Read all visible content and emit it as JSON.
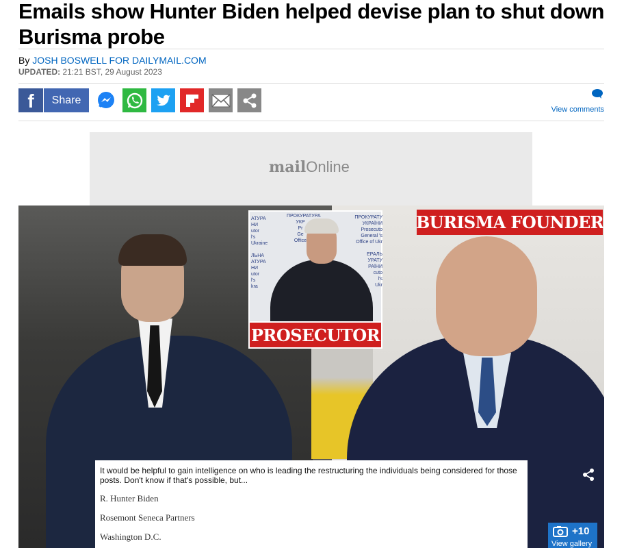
{
  "article": {
    "headline": "Emails show Hunter Biden helped devise plan to shut down Burisma probe",
    "byline_prefix": "By ",
    "author": "JOSH BOSWELL FOR DAILYMAIL.COM",
    "updated_label": "UPDATED:",
    "updated_time": " 21:21 BST, 29 August 2023"
  },
  "share": {
    "facebook_label": "Share",
    "buttons": [
      "messenger-icon",
      "whatsapp-icon",
      "twitter-icon",
      "flipboard-icon",
      "email-icon",
      "share-icon"
    ],
    "colors": {
      "facebook": "#3b5998",
      "whatsapp": "#2fb942",
      "twitter": "#1da1f2",
      "flipboard": "#e12828",
      "grey": "#888888"
    }
  },
  "comments": {
    "label": "View comments"
  },
  "ad": {
    "logo_bold": "mail",
    "logo_light": "Online"
  },
  "image": {
    "prosecutor_caption": "PROSECUTOR",
    "founder_caption": "BURISMA FOUNDER",
    "sign_left": "АТУРА\nНИ\nutor\nl's\nUkraine\n\nЛЬНА\nАТУРА\nНИ\nutor\nl's\nkra",
    "sign_mid": "ПРОКУРАТУРА\nУКР\nPr\nGe\nOffice",
    "sign_right": "ПРОКУРАТУ\nУКРАЇНИ\nProsecuto\nGeneral 's\nOffice of Ukr\n\nЕРАЛЬ\nУРАТУ\nРАЇНИ\ncuto\nl's\nUkr",
    "email_body": "It would be helpful to gain intelligence on who is leading the restructuring  the individuals being considered for those posts.  Don't know if that's possible, but...",
    "signature": [
      "R. Hunter Biden",
      "Rosemont Seneca Partners",
      "Washington D.C."
    ],
    "gallery_count": "+10",
    "gallery_label": "View gallery",
    "accent": "#cf1f1f"
  }
}
